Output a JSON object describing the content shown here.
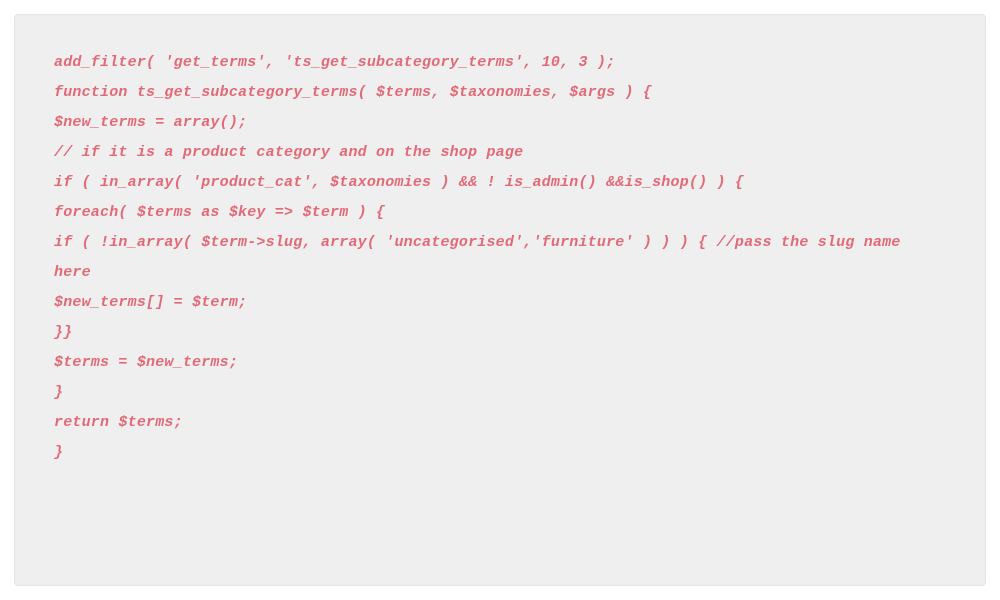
{
  "code": {
    "lines": [
      "add_filter( 'get_terms', 'ts_get_subcategory_terms', 10, 3 );",
      "function ts_get_subcategory_terms( $terms, $taxonomies, $args ) {",
      "$new_terms = array();",
      "// if it is a product category and on the shop page",
      "if ( in_array( 'product_cat', $taxonomies ) && ! is_admin() &&is_shop() ) {",
      "foreach( $terms as $key => $term ) {",
      "if ( !in_array( $term->slug, array( 'uncategorised','furniture' ) ) ) { //pass the slug name here",
      "$new_terms[] = $term;",
      "}}",
      "$terms = $new_terms;",
      "}",
      "return $terms;",
      "}"
    ]
  },
  "colors": {
    "panel_bg": "#efefef",
    "code_fg": "#e26a77"
  }
}
